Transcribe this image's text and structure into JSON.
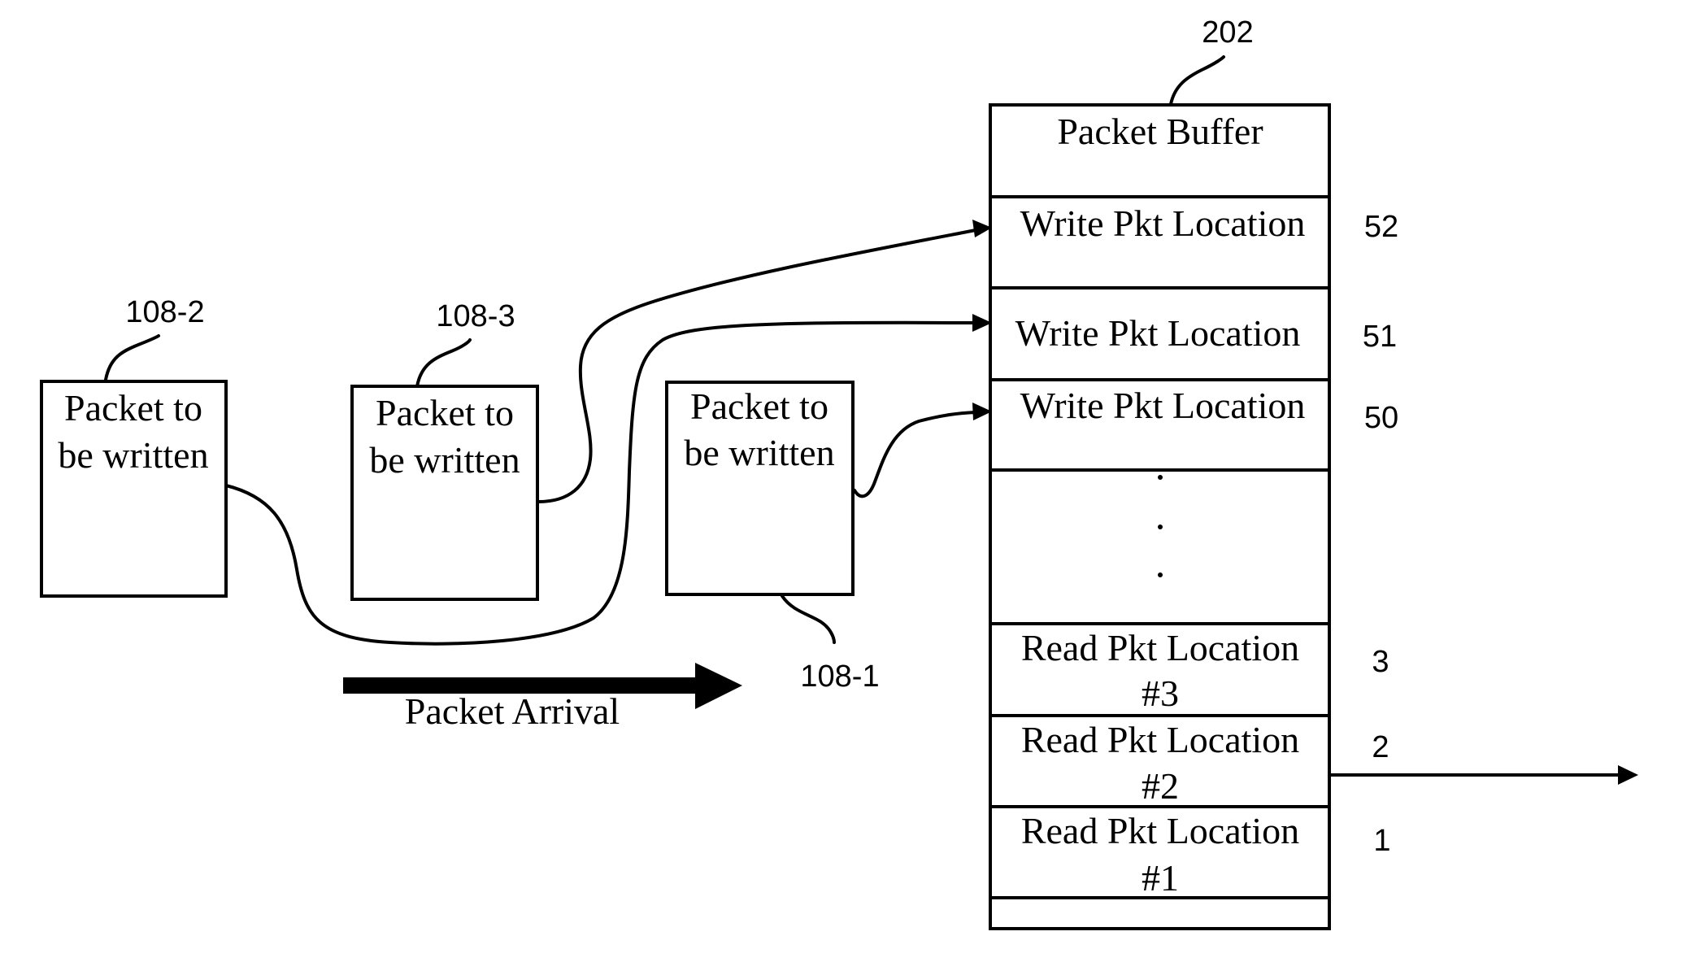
{
  "colors": {
    "ink": "#000000",
    "background": "#ffffff"
  },
  "packets": [
    {
      "ref": "108-2",
      "line1": "Packet to",
      "line2": "be written",
      "target_location": "51"
    },
    {
      "ref": "108-3",
      "line1": "Packet to",
      "line2": "be written",
      "target_location": "52"
    },
    {
      "ref": "108-1",
      "line1": "Packet to",
      "line2": "be written",
      "target_location": "50"
    }
  ],
  "arrival": {
    "label": "Packet Arrival"
  },
  "buffer": {
    "ref": "202",
    "title": "Packet Buffer",
    "rows": [
      {
        "line1": "Write Pkt Location",
        "line2": "",
        "number": "52"
      },
      {
        "line1": "Write Pkt Location",
        "line2": "",
        "number": "51"
      },
      {
        "line1": "Write Pkt Location",
        "line2": "",
        "number": "50"
      },
      {
        "line1": "Read Pkt Location",
        "line2": "#3",
        "number": "3"
      },
      {
        "line1": "Read Pkt Location",
        "line2": "#2",
        "number": "2"
      },
      {
        "line1": "Read Pkt Location",
        "line2": "#1",
        "number": "1"
      }
    ],
    "ellipsis": ".",
    "output_from_row": "2"
  }
}
